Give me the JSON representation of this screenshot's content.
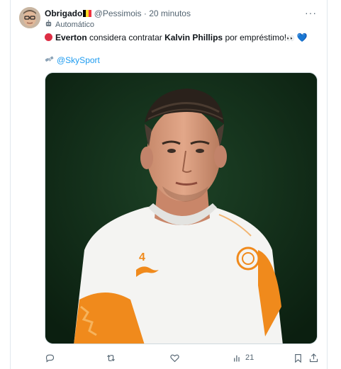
{
  "tweet": {
    "author_name": "Obrigado",
    "handle": "@Pessimois",
    "separator": "·",
    "time": "20 minutos",
    "automated_label": "Automático",
    "text_club": "Everton",
    "text_middle": " considera contratar ",
    "text_player": "Kalvin Phillips",
    "text_end": " por empréstimo!",
    "eyes": "👀",
    "heart": "💙",
    "source_mention": "@SkySport",
    "more": "···"
  },
  "actions": {
    "views_count": "21"
  },
  "kit": {
    "number": "4"
  },
  "colors": {
    "link": "#1d9bf0",
    "muted": "#536471",
    "photo_background": "#123018",
    "shirt": "#f4f4f2",
    "shirt_orange": "#f08a1c"
  },
  "icons": {
    "reply": "reply-icon",
    "repost": "repost-icon",
    "like": "like-icon",
    "views": "views-icon",
    "bookmark": "bookmark-icon",
    "share": "share-icon",
    "more": "more-icon",
    "automated": "robot-icon",
    "source": "satellite-icon",
    "flag": "belgium-flag-icon"
  }
}
